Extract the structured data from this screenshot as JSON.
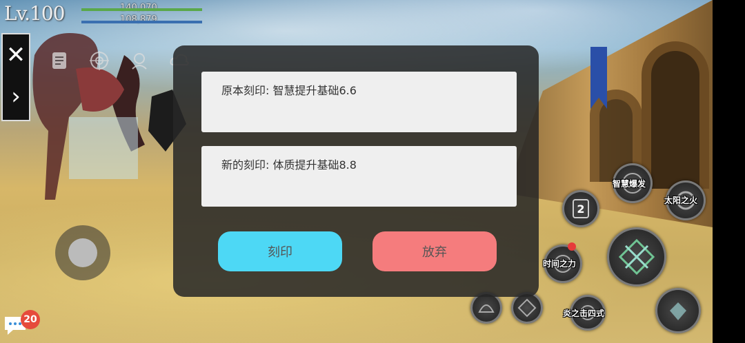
{
  "hud": {
    "level": "Lv.100",
    "hp_value": "140,070",
    "mp_value": "108,879",
    "hp_fill": 1.0,
    "mp_fill": 1.0
  },
  "side_panel": {
    "close_icon": "close-icon",
    "expand_icon": "chevron-right-icon"
  },
  "chat": {
    "badge_count": "20",
    "icon": "chat-bubble-icon"
  },
  "dialog": {
    "original_imprint": "原本刻印: 智慧提升基础6.6",
    "new_imprint": "新的刻印: 体质提升基础8.8",
    "confirm_label": "刻印",
    "cancel_label": "放弃"
  },
  "skills": {
    "wisdom_burst": "智慧爆发",
    "sun_fire": "太阳之火",
    "slot_number": "2",
    "time_force": "时间之力",
    "flame_strike": "炎之击四式"
  },
  "colors": {
    "confirm_button": "#4dd8f5",
    "cancel_button": "#f57c7d",
    "hp_bar": "#5aa84a",
    "mp_bar": "#3a6fb0"
  }
}
